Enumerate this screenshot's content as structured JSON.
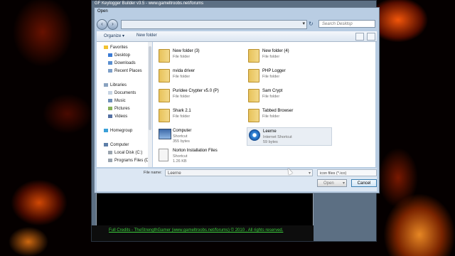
{
  "background_window": {
    "title": "GF Keylogger Builder v3.5 - www.gameltroobs.net/forums",
    "credits": "Full Credits - TheStrengthGamer (www.gameltroobs.net/forums) © 2010 . All rights reserved."
  },
  "dialog": {
    "title": "Open",
    "search_placeholder": "Search Desktop",
    "toolbar": {
      "organize": "Organize ▾",
      "new_folder": "New folder"
    },
    "nav": {
      "favorites": "Favorites",
      "desktop": "Desktop",
      "downloads": "Downloads",
      "recent_places": "Recent Places",
      "libraries": "Libraries",
      "documents": "Documents",
      "music": "Music",
      "pictures": "Pictures",
      "videos": "Videos",
      "homegroup": "Homegroup",
      "computer": "Computer",
      "local_disk": "Local Disk (C:)",
      "program_files": "Programs Files (D"
    },
    "items": [
      {
        "name": "New folder (3)",
        "sub": "File folder",
        "sub2": ""
      },
      {
        "name": "New folder (4)",
        "sub": "File folder",
        "sub2": ""
      },
      {
        "name": "nvida driver",
        "sub": "File folder",
        "sub2": ""
      },
      {
        "name": "PHP Logger",
        "sub": "File folder",
        "sub2": ""
      },
      {
        "name": "Puridee Crypter v5.0 (P)",
        "sub": "File folder",
        "sub2": ""
      },
      {
        "name": "Sam Crypt",
        "sub": "File folder",
        "sub2": ""
      },
      {
        "name": "Shark 2.1",
        "sub": "File folder",
        "sub2": ""
      },
      {
        "name": "Tabbed Browser",
        "sub": "File folder",
        "sub2": ""
      },
      {
        "name": "Computer",
        "sub": "Shortcut",
        "sub2": "355 bytes"
      },
      {
        "name": "Leerne",
        "sub": "Internet Shortcut",
        "sub2": "59 bytes"
      },
      {
        "name": "Norton Installation Files",
        "sub": "Shortcut",
        "sub2": "1.26 KB"
      }
    ],
    "file_name_label": "File name:",
    "file_name_value": "Leerne",
    "file_type": "icon files (*.ico)",
    "open_label": "Open",
    "cancel_label": "Cancel"
  }
}
